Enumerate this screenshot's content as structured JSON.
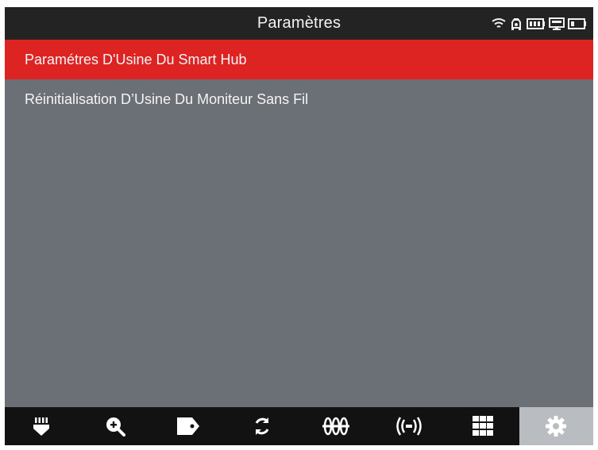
{
  "header": {
    "title": "Paramètres",
    "status_icons": [
      "wifi-icon",
      "vehicle-lock-icon",
      "battery-icon",
      "monitor-icon",
      "battery-low-icon"
    ]
  },
  "menu": {
    "items": [
      {
        "label": "Paramétres D'Usine Du Smart Hub",
        "selected": true
      },
      {
        "label": "Réinitialisation D’Usine Du Moniteur Sans Fil",
        "selected": false
      }
    ]
  },
  "toolbar": {
    "items": [
      {
        "icon": "tpms-sensor-icon"
      },
      {
        "icon": "zoom-in-icon"
      },
      {
        "icon": "tag-icon"
      },
      {
        "icon": "refresh-icon"
      },
      {
        "icon": "axle-icon"
      },
      {
        "icon": "signal-icon"
      },
      {
        "icon": "grid-icon"
      },
      {
        "icon": "gear-icon",
        "active": true
      }
    ]
  },
  "colors": {
    "header_bg": "#232323",
    "screen_bg": "#6b6f76",
    "selected_bg": "#de2323",
    "toolbar_bg": "#121212",
    "toolbar_active_bg": "#b9bcc0"
  }
}
